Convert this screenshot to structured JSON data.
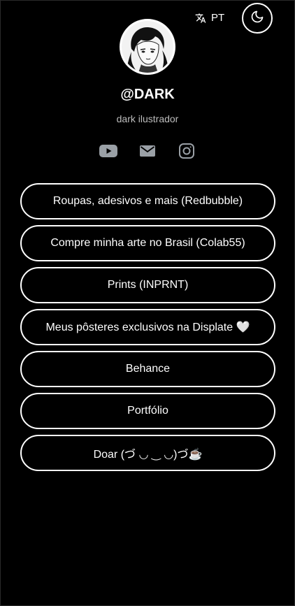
{
  "header": {
    "language": "PT"
  },
  "profile": {
    "username": "@DARK",
    "bio": "dark ilustrador"
  },
  "socials": [
    {
      "icon": "youtube-icon"
    },
    {
      "icon": "mail-icon"
    },
    {
      "icon": "instagram-icon"
    }
  ],
  "links": [
    {
      "label": "Roupas, adesivos e mais (Redbubble)"
    },
    {
      "label": "Compre minha arte no Brasil (Colab55)"
    },
    {
      "label": "Prints (INPRNT)"
    },
    {
      "label": "Meus pôsteres exclusivos na Displate 🤍"
    },
    {
      "label": "Behance"
    },
    {
      "label": "Portfólio"
    },
    {
      "label": "Doar (づ ◡ ‿ ◡)づ☕"
    }
  ],
  "colors": {
    "background": "#000000",
    "text": "#ffffff",
    "muted": "#bdbdbd",
    "icon": "#9aa0a6"
  }
}
